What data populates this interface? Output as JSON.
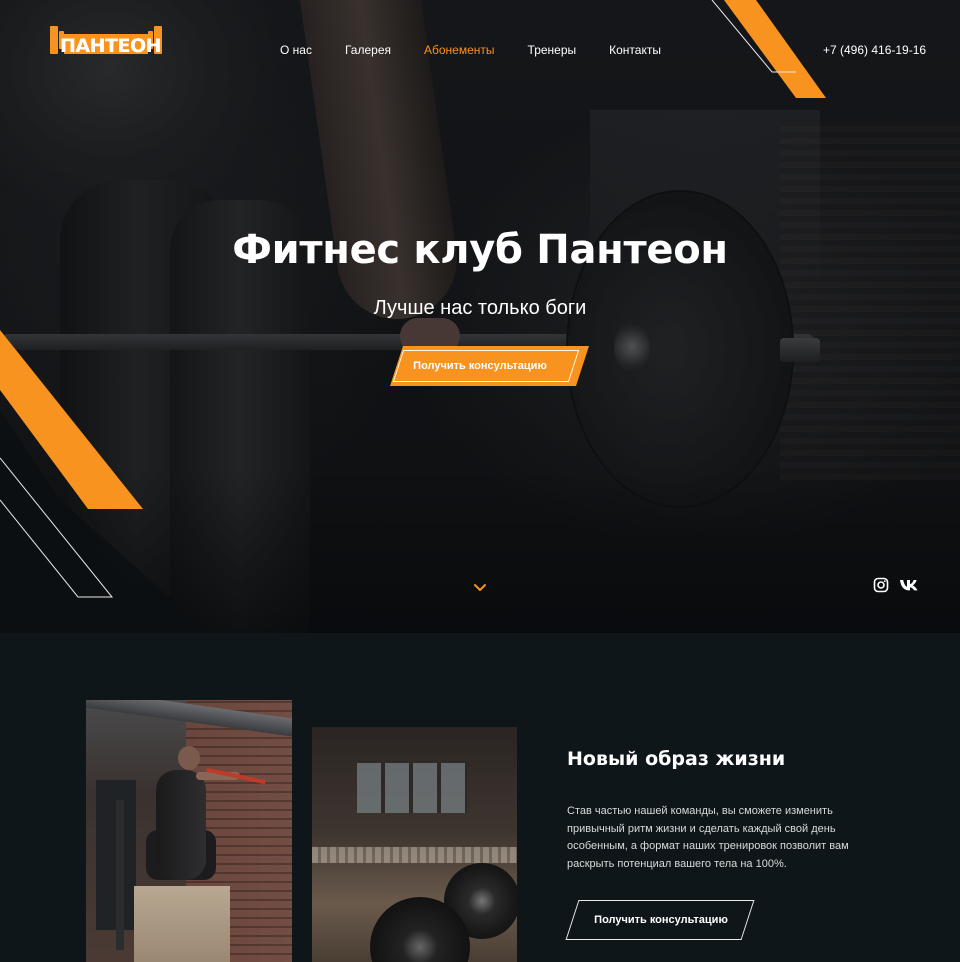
{
  "brand": {
    "logo_text": "ПАНТЕОН",
    "accent_color": "#f7931e",
    "background_color": "#0f161a"
  },
  "header": {
    "nav": [
      {
        "label": "О нас",
        "active": false
      },
      {
        "label": "Галерея",
        "active": false
      },
      {
        "label": "Абонементы",
        "active": true
      },
      {
        "label": "Тренеры",
        "active": false
      },
      {
        "label": "Контакты",
        "active": false
      }
    ],
    "phone": "+7 (496) 416-19-16"
  },
  "hero": {
    "title": "Фитнес клуб Пантеон",
    "subtitle": "Лучше нас только боги",
    "cta_label": "Получить консультацию",
    "scroll_icon": "chevron-down-icon",
    "socials": [
      {
        "name": "instagram-icon"
      },
      {
        "name": "vk-icon"
      }
    ]
  },
  "about": {
    "title": "Новый образ жизни",
    "text": "Став частью нашей команды, вы сможете изменить привычный ритм жизни и сделать каждый свой день особенным, а формат наших тренировок позволит вам раскрыть потенциал вашего тела на 100%.",
    "cta_label": "Получить консультацию"
  }
}
